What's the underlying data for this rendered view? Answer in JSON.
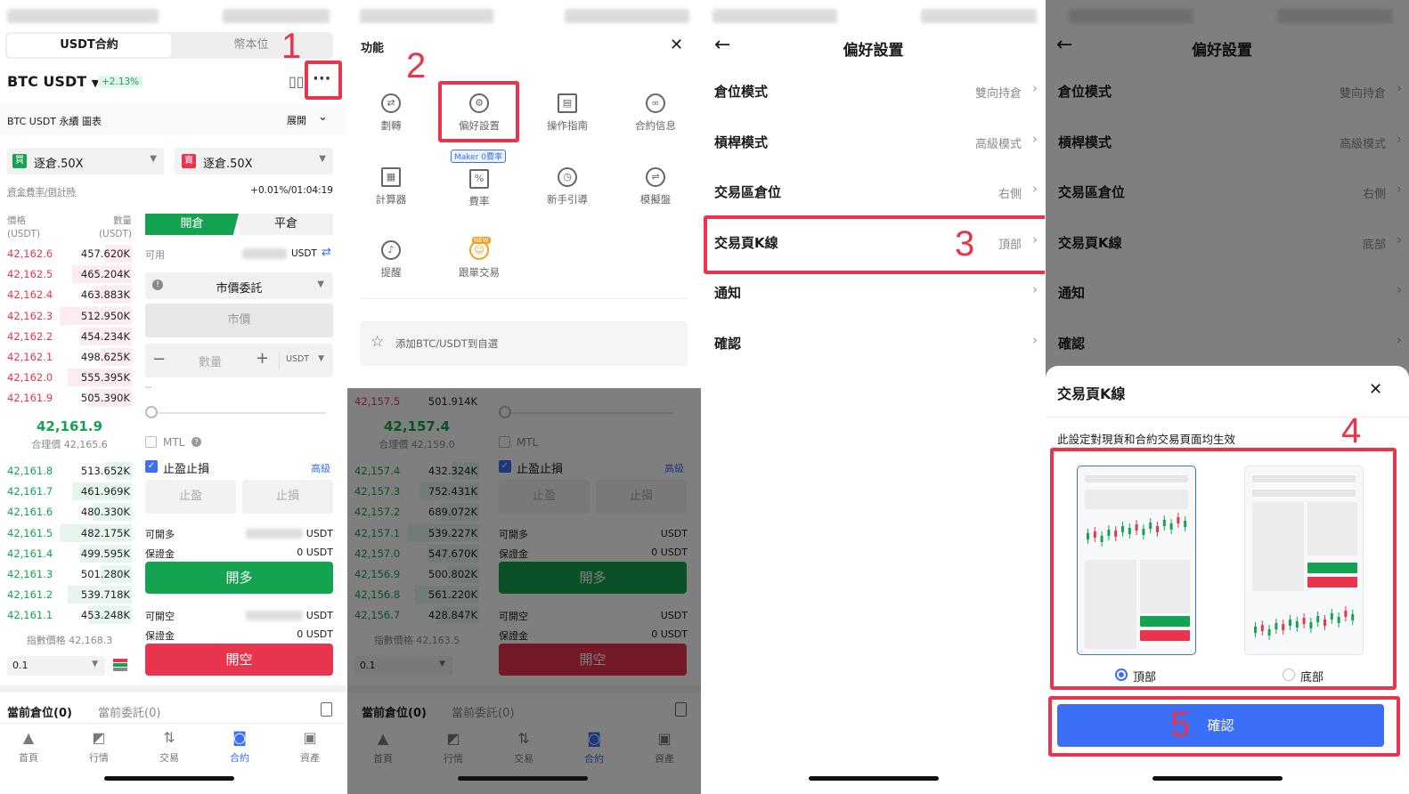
{
  "p1": {
    "tab_active": "USDT合約",
    "tab_inactive": "幣本位",
    "pair": "BTC USDT",
    "pair_arrow": "▼",
    "change": "+2.13%",
    "chart_label": "BTC USDT 永續 圖表",
    "expand": "展開",
    "margin_long_badge": "買",
    "margin_long": "逐倉.50X",
    "margin_short_badge": "賣",
    "margin_short": "逐倉.50X",
    "funding_label": "資金費率/倒計時",
    "funding_value": "+0.01%/01:04:19",
    "col_price": "價格",
    "col_price_unit": "(USDT)",
    "col_qty": "數量",
    "col_qty_unit": "(USDT)",
    "asks": [
      {
        "p": "42,162.6",
        "q": "457.620K"
      },
      {
        "p": "42,162.5",
        "q": "465.204K"
      },
      {
        "p": "42,162.4",
        "q": "463.883K"
      },
      {
        "p": "42,162.3",
        "q": "512.950K"
      },
      {
        "p": "42,162.2",
        "q": "454.234K"
      },
      {
        "p": "42,162.1",
        "q": "498.625K"
      },
      {
        "p": "42,162.0",
        "q": "555.395K"
      },
      {
        "p": "42,161.9",
        "q": "505.390K"
      }
    ],
    "last_price": "42,161.9",
    "fair_price": "合理價 42,165.6",
    "bids": [
      {
        "p": "42,161.8",
        "q": "513.652K"
      },
      {
        "p": "42,161.7",
        "q": "461.969K"
      },
      {
        "p": "42,161.6",
        "q": "480.330K"
      },
      {
        "p": "42,161.5",
        "q": "482.175K"
      },
      {
        "p": "42,161.4",
        "q": "499.595K"
      },
      {
        "p": "42,161.3",
        "q": "501.280K"
      },
      {
        "p": "42,161.2",
        "q": "539.718K"
      },
      {
        "p": "42,161.1",
        "q": "453.248K"
      }
    ],
    "index_price": "指數價格 42,168.3",
    "depth": "0.1",
    "open_tab": "開倉",
    "close_tab": "平倉",
    "available": "可用",
    "available_unit": "USDT",
    "order_type": "市價委託",
    "market": "市價",
    "qty_placeholder": "數量",
    "qty_unit": "USDT",
    "dash": "--",
    "mtl": "MTL",
    "tpsl": "止盈止損",
    "advanced": "高級",
    "tp": "止盈",
    "sl": "止損",
    "can_long": "可開多",
    "can_long_unit": "USDT",
    "margin1": "保證金",
    "margin1_value": "0 USDT",
    "open_long": "開多",
    "can_short": "可開空",
    "can_short_unit": "USDT",
    "margin2": "保證金",
    "margin2_value": "0 USDT",
    "open_short": "開空",
    "positions": "當前倉位(0)",
    "orders": "當前委託(0)",
    "tabs": [
      "首頁",
      "行情",
      "交易",
      "合約",
      "資產"
    ],
    "step": "1"
  },
  "p2": {
    "title": "功能",
    "close": "✕",
    "items": [
      "劃轉",
      "偏好設置",
      "操作指南",
      "合約信息",
      "計算器",
      "費率",
      "新手引導",
      "模擬盤",
      "提醒",
      "跟單交易"
    ],
    "maker_badge": "Maker 0費率",
    "new_badge": "NEW",
    "favorite": "添加BTC/USDT到自選",
    "asks_tail": {
      "p": "42,157.5",
      "q": "501.914K"
    },
    "last_price": "42,157.4",
    "fair_price": "合理價 42,159.0",
    "bids": [
      {
        "p": "42,157.4",
        "q": "432.324K"
      },
      {
        "p": "42,157.3",
        "q": "752.431K"
      },
      {
        "p": "42,157.2",
        "q": "689.072K"
      },
      {
        "p": "42,157.1",
        "q": "539.227K"
      },
      {
        "p": "42,157.0",
        "q": "547.670K"
      },
      {
        "p": "42,156.9",
        "q": "500.802K"
      },
      {
        "p": "42,156.8",
        "q": "561.220K"
      },
      {
        "p": "42,156.7",
        "q": "428.847K"
      }
    ],
    "index_price": "指數價格 42,163.5",
    "step": "2"
  },
  "p3": {
    "title": "偏好設置",
    "back": "←",
    "rows": [
      {
        "label": "倉位模式",
        "value": "雙向持倉"
      },
      {
        "label": "槓桿模式",
        "value": "高級模式"
      },
      {
        "label": "交易區倉位",
        "value": "右側"
      },
      {
        "label": "交易頁K線",
        "value": "頂部"
      },
      {
        "label": "通知",
        "value": ""
      },
      {
        "label": "確認",
        "value": ""
      }
    ],
    "chev": "›",
    "step": "3"
  },
  "p4": {
    "title": "偏好設置",
    "rows": [
      {
        "label": "倉位模式",
        "value": "雙向持倉"
      },
      {
        "label": "槓桿模式",
        "value": "高級模式"
      },
      {
        "label": "交易區倉位",
        "value": "右側"
      },
      {
        "label": "交易頁K線",
        "value": "底部"
      },
      {
        "label": "通知",
        "value": ""
      },
      {
        "label": "確認",
        "value": ""
      }
    ],
    "sheet_title": "交易頁K線",
    "sheet_desc": "此設定對現貨和合約交易頁面均生效",
    "opt_top": "頂部",
    "opt_bottom": "底部",
    "confirm": "確認",
    "step4": "4",
    "step5": "5"
  }
}
